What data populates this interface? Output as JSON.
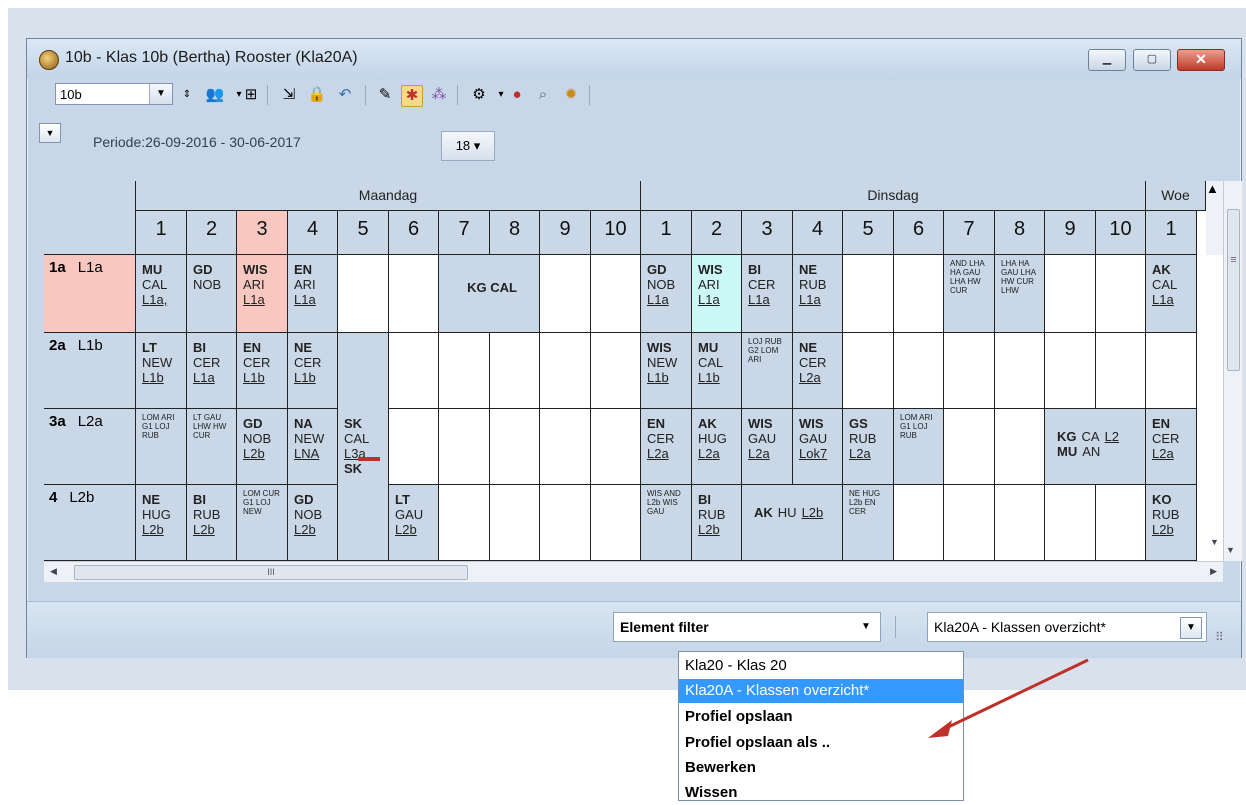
{
  "window": {
    "title": "10b - Klas 10b (Bertha)  Rooster  (Kla20A)",
    "minimize_label": "▁",
    "maximize_label": "▢",
    "close_label": "✕"
  },
  "toolbar": {
    "class_value": "10b",
    "drop_arrow": "▼"
  },
  "periode": {
    "text": "Periode:26-09-2016 - 30-06-2017",
    "calendar_label": "18 ▾",
    "collapse_arrow": "▼"
  },
  "days": [
    "Maandag",
    "Dinsdag",
    "Woe"
  ],
  "periods": [
    "1",
    "2",
    "3",
    "4",
    "5",
    "6",
    "7",
    "8",
    "9",
    "10",
    "1",
    "2",
    "3",
    "4",
    "5",
    "6",
    "7",
    "8",
    "9",
    "10",
    "1"
  ],
  "rows": [
    {
      "num": "1a",
      "code": "L1a"
    },
    {
      "num": "2a",
      "code": "L1b"
    },
    {
      "num": "3a",
      "code": "L2a"
    },
    {
      "num": "4",
      "code": "L2b"
    }
  ],
  "lessons": {
    "r0": {
      "m1": [
        "MU",
        "CAL",
        "L1a,"
      ],
      "m2": [
        "GD",
        "NOB",
        ""
      ],
      "m3": [
        "WIS",
        "ARI",
        "L1a"
      ],
      "m4": [
        "EN",
        "ARI",
        "L1a"
      ],
      "m78": "KG CAL",
      "d1": [
        "GD",
        "NOB",
        "L1a"
      ],
      "d2": [
        "WIS",
        "ARI",
        "L1a"
      ],
      "d3": [
        "BI",
        "CER",
        "L1a"
      ],
      "d4": [
        "NE",
        "RUB",
        "L1a"
      ],
      "d7": "AND LHA HA GAU LHA HW CUR",
      "d8": "LHA HA GAU LHA HW CUR LHW",
      "w1": [
        "AK",
        "CAL",
        "L1a"
      ]
    },
    "r1": {
      "m1": [
        "LT",
        "NEW",
        "L1b"
      ],
      "m2": [
        "BI",
        "CER",
        "L1a"
      ],
      "m3": [
        "EN",
        "CER",
        "L1b"
      ],
      "m4": [
        "NE",
        "CER",
        "L1b"
      ],
      "d1": [
        "WIS",
        "NEW",
        "L1b"
      ],
      "d2": [
        "MU",
        "CAL",
        "L1b"
      ],
      "d3": "LOJ RUB G2 LOM ARI",
      "d4": [
        "NE",
        "CER",
        "L2a"
      ]
    },
    "r2": {
      "m1": "LOM ARI G1 LOJ RUB",
      "m2": "LT GAU LHW HW CUR",
      "m3": [
        "GD",
        "NOB",
        "L2b"
      ],
      "m4": [
        "NA",
        "NEW",
        "LNA"
      ],
      "m5": [
        "SK",
        "CAL",
        "L3a"
      ],
      "m5b": "SK",
      "d1": [
        "EN",
        "CER",
        "L2a"
      ],
      "d2": [
        "AK",
        "HUG",
        "L2a"
      ],
      "d3": [
        "WIS",
        "GAU",
        "L2a"
      ],
      "d4": [
        "WIS",
        "GAU",
        "Lok7"
      ],
      "d5": [
        "GS",
        "RUB",
        "L2a"
      ],
      "d6": "LOM ARI G1 LOJ RUB",
      "d910a": "KG",
      "d910b": "CA",
      "d910c": "L2",
      "d910d": "MU",
      "d910e": "AN",
      "w1": [
        "EN",
        "CER",
        "L2a"
      ]
    },
    "r3": {
      "m1": [
        "NE",
        "HUG",
        "L2b"
      ],
      "m2": [
        "BI",
        "RUB",
        "L2b"
      ],
      "m3": "LOM CUR G1 LOJ NEW",
      "m4": [
        "GD",
        "NOB",
        "L2b"
      ],
      "m6": [
        "LT",
        "GAU",
        "L2b"
      ],
      "d1": "WIS AND L2b WIS GAU",
      "d2": [
        "BI",
        "RUB",
        "L2b"
      ],
      "d34a": "AK",
      "d34b": "HU",
      "d34c": "L2b",
      "d5": "NE HUG L2b EN CER",
      "w1": [
        "KO",
        "RUB",
        "L2b"
      ]
    }
  },
  "scroll": {
    "up": "▲",
    "down": "▼",
    "left": "◀",
    "right": "▶",
    "grip": "III",
    "vgrip": "≡"
  },
  "status": {
    "filter_label": "Element filter",
    "profile_value": "Kla20A - Klassen overzicht*",
    "arrow": "▼"
  },
  "dropdown": [
    {
      "label": "Kla20 - Klas 20"
    },
    {
      "label": "Kla20A - Klassen overzicht*"
    },
    {
      "label": "Profiel opslaan"
    },
    {
      "label": "Profiel opslaan als .."
    },
    {
      "label": "Bewerken"
    },
    {
      "label": "Wissen"
    }
  ],
  "colors": {
    "highlight_pink": "#f8c7c0",
    "highlight_cyan": "#ccf7f7",
    "accent_arrow": "#c0302a",
    "selection": "#3399ff"
  },
  "icons": [
    "clock-icon",
    "people-icon",
    "grid-icon",
    "export-icon",
    "lock-icon",
    "undo-icon",
    "pencil-icon",
    "pin-icon",
    "share-icon",
    "settings-icon",
    "traffic-light-icon",
    "search-icon",
    "gear-icon"
  ]
}
